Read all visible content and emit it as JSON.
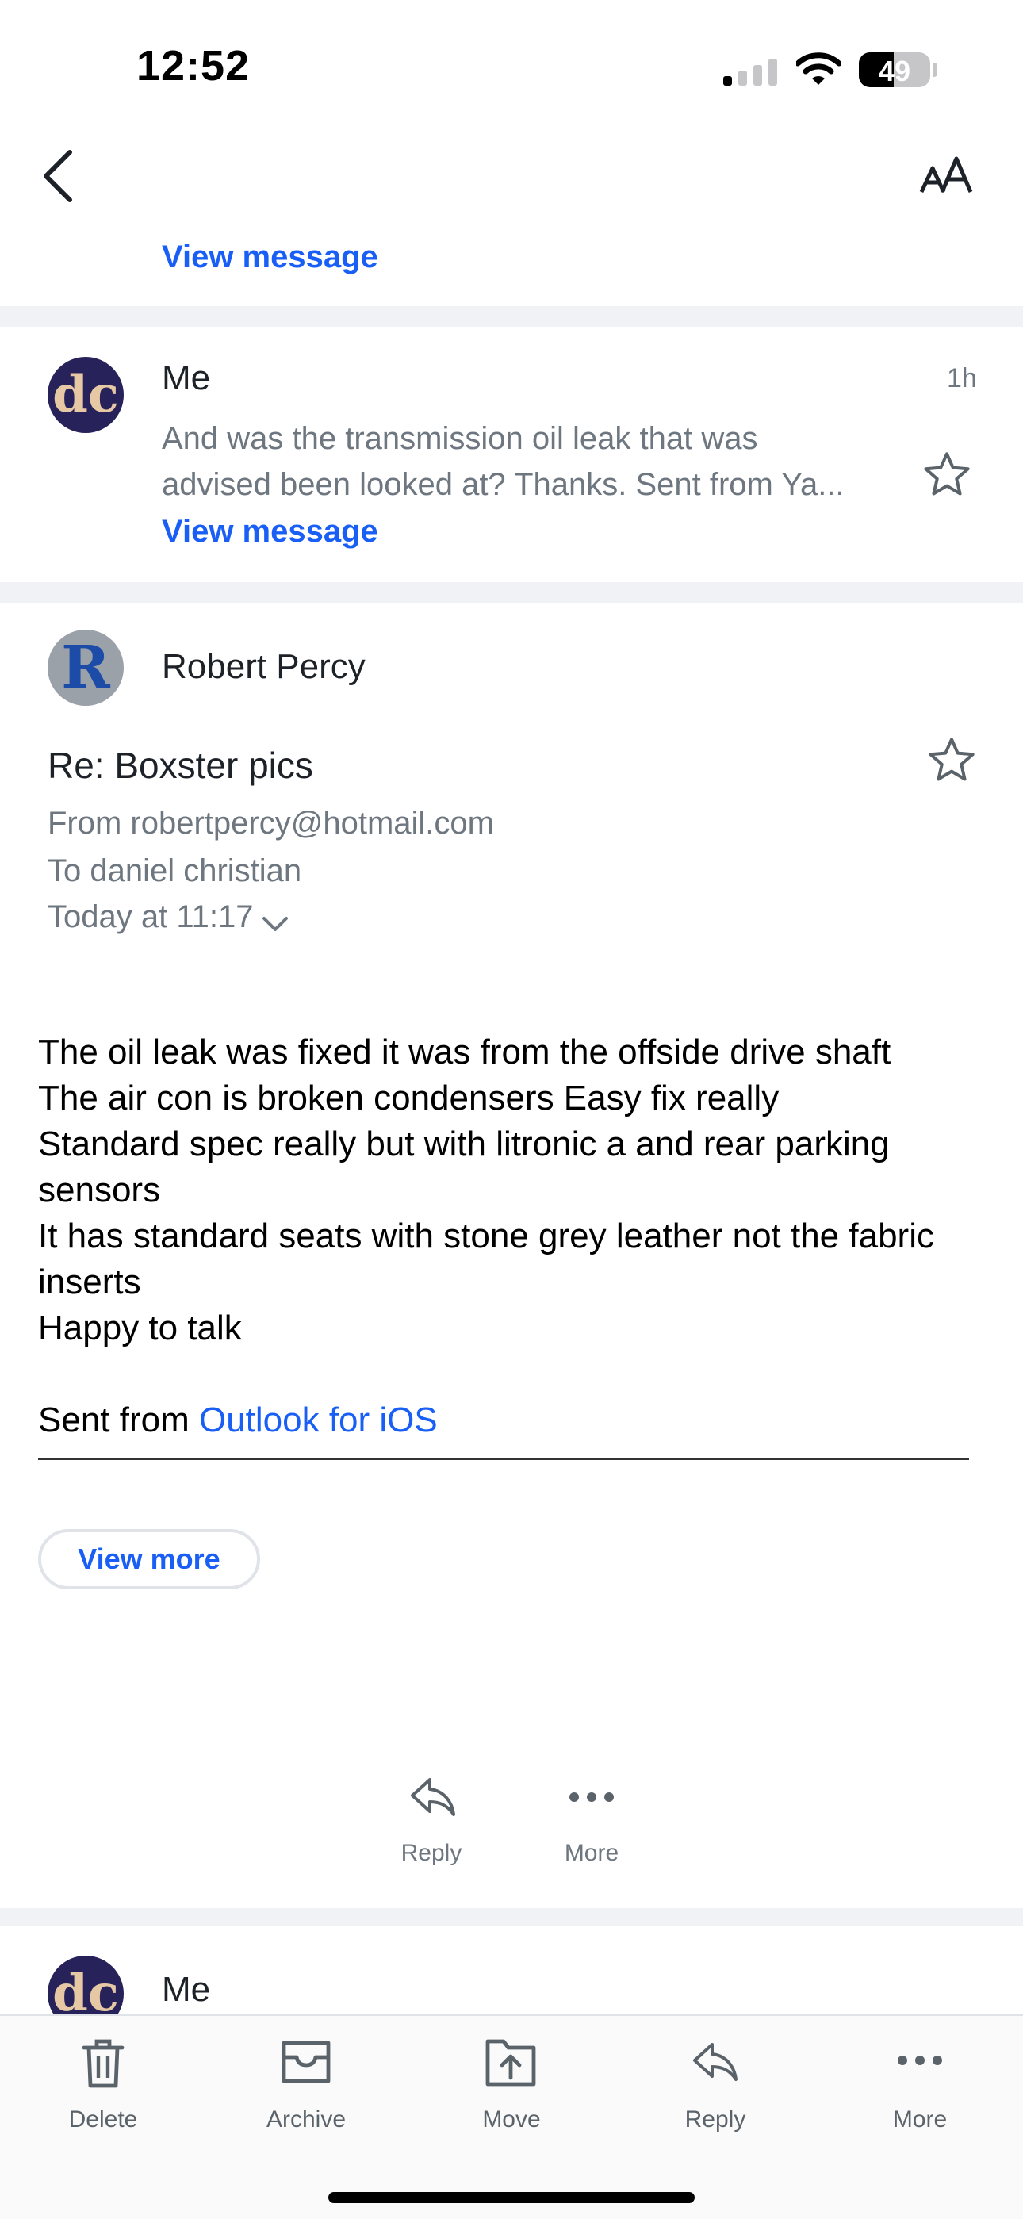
{
  "status_bar": {
    "time": "12:52",
    "battery": "49",
    "battery_level": 0.49
  },
  "header": {
    "back_icon": "chevron-left-icon",
    "text_size_icon": "text-size-icon"
  },
  "thread_items": [
    {
      "view_link": "View message"
    },
    {
      "sender": "Me",
      "avatar_initials": "dc",
      "time": "1h",
      "snippet_line1": "And was the transmission oil leak that was",
      "snippet_line2": "advised been looked at? Thanks. Sent from Ya...",
      "view_link": "View message"
    }
  ],
  "open_message": {
    "sender": "Robert Percy",
    "avatar_initial": "R",
    "subject": "Re: Boxster pics",
    "from": "From robertpercy@hotmail.com",
    "to": "To daniel christian",
    "date": "Today at 11:17",
    "body_lines": [
      "The oil leak was fixed it was from the offside drive shaft",
      "The air con is broken condensers Easy fix really",
      "Standard spec really but with litronic a and rear parking",
      "sensors",
      "It has standard seats with stone grey leather not the fabric",
      "inserts",
      "Happy to talk"
    ],
    "signature_prefix": "Sent from ",
    "signature_link": "Outlook for iOS",
    "view_more": "View more",
    "actions": {
      "reply": "Reply",
      "more": "More"
    }
  },
  "next_item": {
    "sender": "Me",
    "avatar_initials": "dc"
  },
  "toolbar": {
    "delete": "Delete",
    "archive": "Archive",
    "move": "Move",
    "reply": "Reply",
    "more": "More"
  },
  "colors": {
    "accent": "#1a5ff5",
    "separator": "#f0f2f5",
    "muted_text": "#6e7780"
  }
}
